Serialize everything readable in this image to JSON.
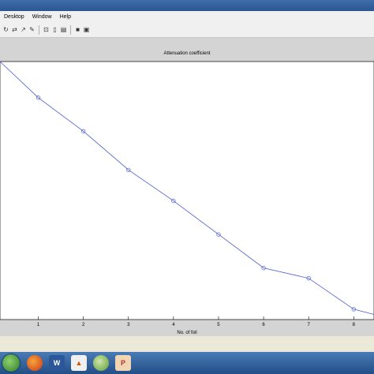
{
  "menu": {
    "items": [
      "Desktop",
      "Window",
      "Help"
    ]
  },
  "toolbar": {
    "icons": [
      "new-figure-icon",
      "open-icon",
      "arrow-icon",
      "zoom-icon",
      "colorbar-icon",
      "legend-icon",
      "hide-tools-icon",
      "dock-icon"
    ]
  },
  "taskbar": {
    "icons": [
      "start-orb",
      "firefox-icon",
      "word-icon",
      "matlab-icon",
      "globe-icon",
      "pdf-icon"
    ]
  },
  "chart_data": {
    "type": "line",
    "title": "Attenuation coefficient",
    "xlabel": "No. of foil",
    "ylabel": "",
    "x_ticks": [
      1,
      2,
      3,
      4,
      5,
      6,
      7,
      8
    ],
    "xlim": [
      0.15,
      8.45
    ],
    "ylim": [
      0.0,
      1.0
    ],
    "grid": false,
    "series": [
      {
        "x": [
          0.15,
          1,
          2,
          3,
          4,
          5,
          6,
          7,
          8,
          8.45
        ],
        "y": [
          1.0,
          0.86,
          0.73,
          0.58,
          0.46,
          0.33,
          0.2,
          0.16,
          0.04,
          0.02
        ],
        "markers": [
          false,
          true,
          true,
          true,
          true,
          true,
          true,
          true,
          true,
          false
        ],
        "color": "#4b5ccd"
      }
    ]
  }
}
